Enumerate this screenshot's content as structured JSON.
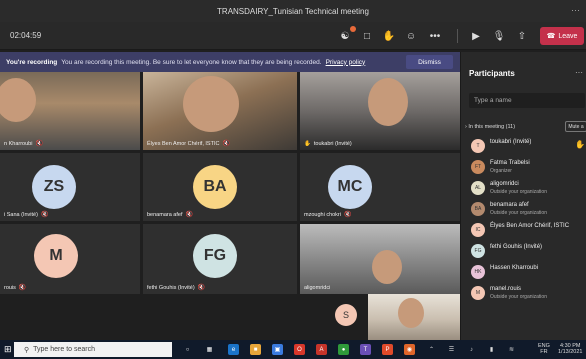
{
  "window": {
    "title": "TRANSDAIRY_Tunisian Technical meeting"
  },
  "toolbar": {
    "timer": "02:04:59",
    "leave_label": "Leave",
    "icons": [
      "participants-icon",
      "chat-icon",
      "raise-hand-icon",
      "reactions-icon",
      "more-icon",
      "camera-icon",
      "mic-off-icon",
      "share-icon",
      "phone-hangup-icon"
    ]
  },
  "banner": {
    "title": "You're recording",
    "message": "You are recording this meeting. Be sure to let everyone know that they are being recorded.",
    "link": "Privacy policy",
    "dismiss": "Dismiss",
    "bg_color": "#3d3e66"
  },
  "tiles": [
    {
      "name": "n Kharroubi",
      "kind": "video"
    },
    {
      "name": "Élyes Ben Amor Chérif, ISTIC",
      "kind": "video"
    },
    {
      "name": "toukabri (Invité)",
      "kind": "video"
    },
    {
      "name": "i Sana (Invité)",
      "initials": "ZS",
      "color": "#c7d8ef"
    },
    {
      "name": "benamara afef",
      "initials": "BA",
      "color": "#f8d585"
    },
    {
      "name": "mzoughi chokri",
      "initials": "MC",
      "color": "#c7d8ef"
    },
    {
      "name": "rouis",
      "initials": "M",
      "color": "#f4c7b4"
    },
    {
      "name": "fethi Gouhis (Invité)",
      "initials": "FG",
      "color": "#cfe3e3"
    },
    {
      "name": "aligomridci",
      "kind": "video"
    },
    {
      "initials": "S",
      "color": "#f4c7b4"
    }
  ],
  "panel": {
    "title": "Participants",
    "search_placeholder": "Type a name",
    "in_meeting": "In this meeting (11)",
    "mute_all": "Mute a",
    "participants": [
      {
        "name": "toukabri (Invité)",
        "sub": "",
        "initials": "T",
        "color": "#f4c7b4",
        "hand": true
      },
      {
        "name": "Fatma Trabelsi",
        "sub": "Organizer",
        "initials": "FT",
        "color": "#c98a5e",
        "hand": false
      },
      {
        "name": "aligomridci",
        "sub": "Outside your organization",
        "initials": "AL",
        "color": "#e3e0c8",
        "hand": false
      },
      {
        "name": "benamara afef",
        "sub": "Outside your organization",
        "initials": "BA",
        "color": "#b38a6e",
        "hand": false
      },
      {
        "name": "Élyes Ben Amor Chérif, ISTIC",
        "sub": "",
        "initials": "IC",
        "color": "#f4c7b4",
        "hand": false
      },
      {
        "name": "fethi Gouhis (Invité)",
        "sub": "",
        "initials": "FG",
        "color": "#cfe3e3",
        "hand": false
      },
      {
        "name": "Hassen Kharroubi",
        "sub": "",
        "initials": "HK",
        "color": "#e8c3d8",
        "hand": false
      },
      {
        "name": "manel.rouis",
        "sub": "Outside your organization",
        "initials": "M",
        "color": "#f4c7b4",
        "hand": false
      }
    ]
  },
  "taskbar": {
    "search_placeholder": "Type here to search",
    "lang": "ENG",
    "region": "FR",
    "time": "4:30 PM",
    "date": "1/13/2021"
  }
}
